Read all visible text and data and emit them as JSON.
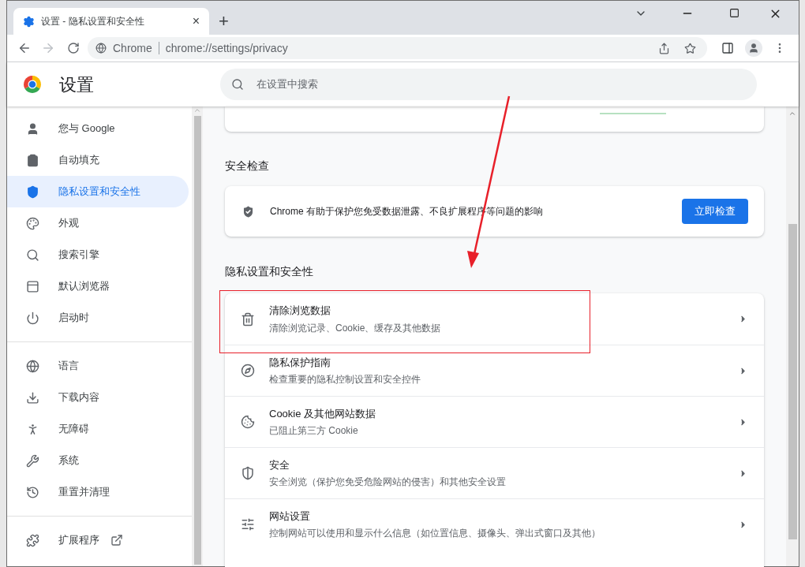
{
  "tab": {
    "title": "设置 - 隐私设置和安全性",
    "close": "×"
  },
  "new_tab": "+",
  "address_bar": {
    "site": "Chrome",
    "url": "chrome://settings/privacy"
  },
  "header": {
    "title": "设置",
    "search_placeholder": "在设置中搜索"
  },
  "sidebar": {
    "groups": [
      [
        {
          "label": "您与 Google",
          "selected": false,
          "external": false
        },
        {
          "label": "自动填充",
          "selected": false,
          "external": false
        },
        {
          "label": "隐私设置和安全性",
          "selected": true,
          "external": false
        },
        {
          "label": "外观",
          "selected": false,
          "external": false
        },
        {
          "label": "搜索引擎",
          "selected": false,
          "external": false
        },
        {
          "label": "默认浏览器",
          "selected": false,
          "external": false
        },
        {
          "label": "启动时",
          "selected": false,
          "external": false
        }
      ],
      [
        {
          "label": "语言",
          "selected": false,
          "external": false
        },
        {
          "label": "下载内容",
          "selected": false,
          "external": false
        },
        {
          "label": "无障碍",
          "selected": false,
          "external": false
        },
        {
          "label": "系统",
          "selected": false,
          "external": false
        },
        {
          "label": "重置并清理",
          "selected": false,
          "external": false
        }
      ],
      [
        {
          "label": "扩展程序",
          "selected": false,
          "external": true
        }
      ]
    ]
  },
  "safety_check": {
    "heading": "安全检查",
    "text": "Chrome 有助于保护您免受数据泄露、不良扩展程序等问题的影响",
    "button": "立即检查"
  },
  "privacy": {
    "heading": "隐私设置和安全性",
    "rows": [
      {
        "title": "清除浏览数据",
        "subtitle": "清除浏览记录、Cookie、缓存及其他数据",
        "highlighted": true
      },
      {
        "title": "隐私保护指南",
        "subtitle": "检查重要的隐私控制设置和安全控件",
        "highlighted": false
      },
      {
        "title": "Cookie 及其他网站数据",
        "subtitle": "已阻止第三方 Cookie",
        "highlighted": false
      },
      {
        "title": "安全",
        "subtitle": "安全浏览（保护您免受危险网站的侵害）和其他安全设置",
        "highlighted": false
      },
      {
        "title": "网站设置",
        "subtitle": "控制网站可以使用和显示什么信息（如位置信息、摄像头、弹出式窗口及其他）",
        "highlighted": false
      }
    ]
  }
}
